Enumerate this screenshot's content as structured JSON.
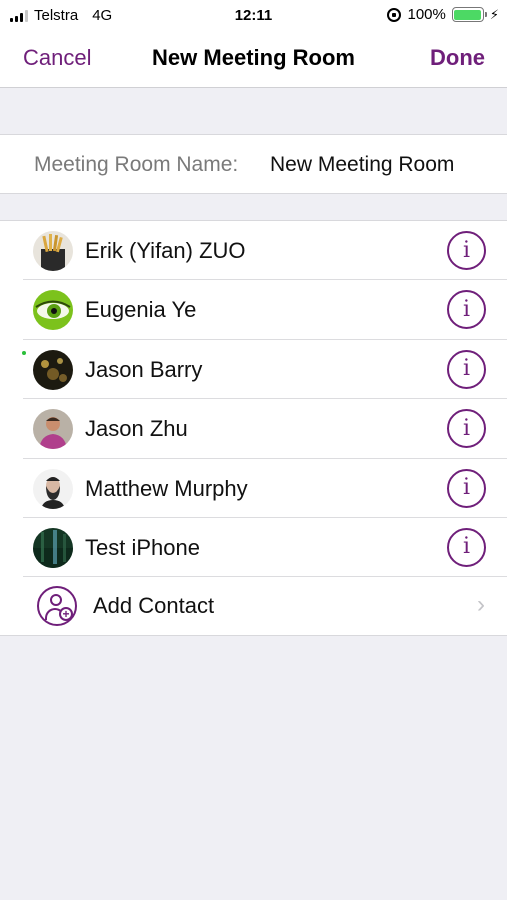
{
  "status": {
    "carrier": "Telstra",
    "network": "4G",
    "time": "12:11",
    "battery": "100%"
  },
  "nav": {
    "cancel": "Cancel",
    "title": "New Meeting Room",
    "done": "Done"
  },
  "room": {
    "label": "Meeting Room Name:",
    "value": "New Meeting Room"
  },
  "contacts": [
    {
      "name": "Erik (Yifan) ZUO",
      "avatar": "fries-photo"
    },
    {
      "name": "Eugenia Ye",
      "avatar": "green-eye-photo"
    },
    {
      "name": "Jason Barry",
      "avatar": "dark-lights-photo",
      "presence": "online"
    },
    {
      "name": "Jason Zhu",
      "avatar": "man-photo"
    },
    {
      "name": "Matthew Murphy",
      "avatar": "bearded-man-photo"
    },
    {
      "name": "Test iPhone",
      "avatar": "forest-photo"
    }
  ],
  "add_contact": {
    "label": "Add Contact"
  },
  "colors": {
    "accent": "#6f1f7a",
    "background": "#efeff4",
    "battery": "#4cd964"
  }
}
